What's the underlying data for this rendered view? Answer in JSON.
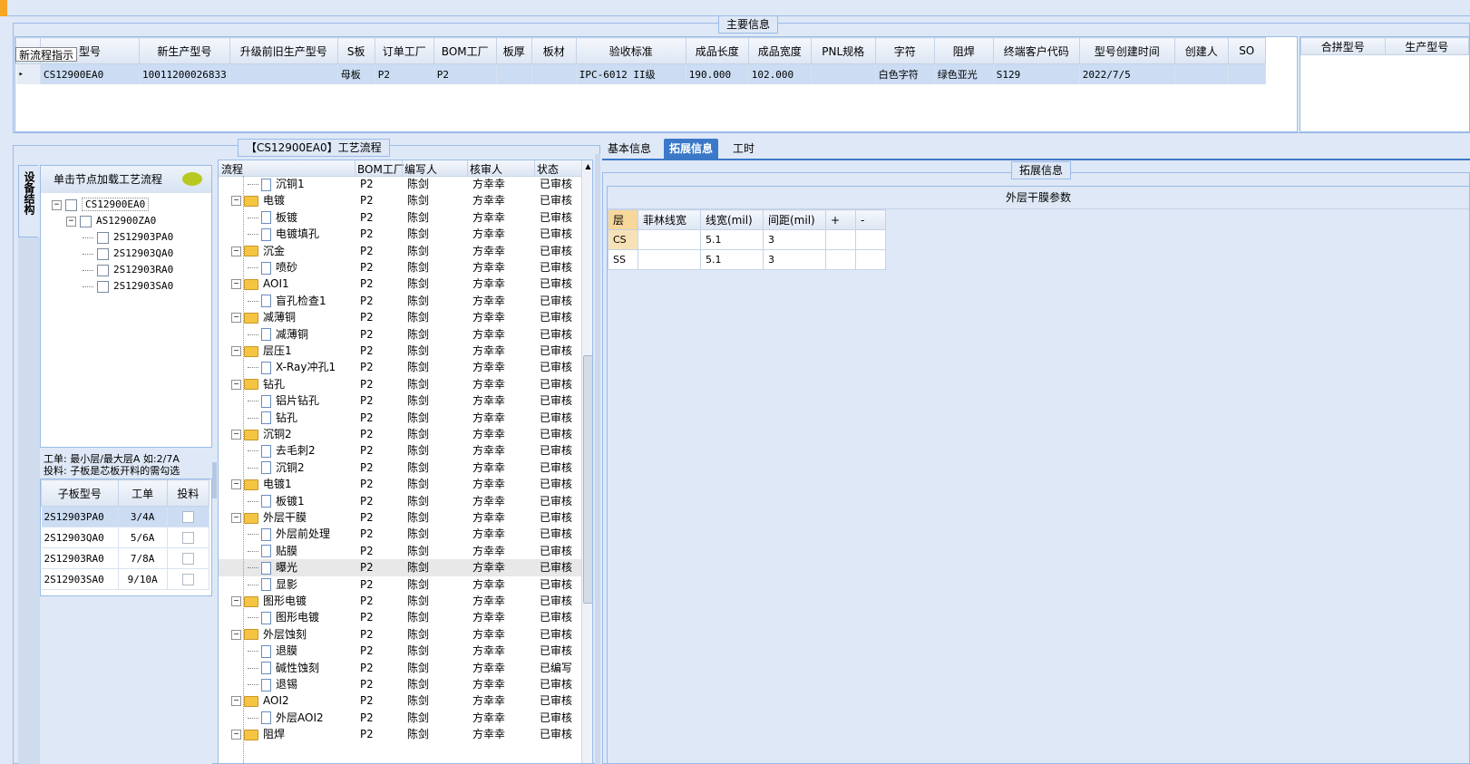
{
  "main_info": {
    "caption": "主要信息",
    "tooltip": "新流程指示",
    "columns": [
      "型号",
      "新生产型号",
      "升级前旧生产型号",
      "S板",
      "订单工厂",
      "BOM工厂",
      "板厚",
      "板材",
      "验收标准",
      "成品长度",
      "成品宽度",
      "PNL规格",
      "字符",
      "阻焊",
      "终端客户代码",
      "型号创建时间",
      "创建人",
      "SO"
    ],
    "row": [
      "CS12900EA0",
      "10011200026833",
      "",
      "母板",
      "P2",
      "P2",
      "",
      "",
      "IPC-6012 II级",
      "190.000",
      "102.000",
      "",
      "白色字符",
      "绿色亚光",
      "S129",
      "2022/7/5",
      "",
      ""
    ],
    "right_columns": [
      "合拼型号",
      "生产型号"
    ]
  },
  "left": {
    "vertical_tab": "设备结构",
    "hint": "单击节点加载工艺流程",
    "tree": [
      "CS12900EA0",
      "AS12900ZA0",
      "2S12903PA0",
      "2S12903QA0",
      "2S12903RA0",
      "2S12903SA0"
    ],
    "note1": "工单: 最小层/最大层A 如:2/7A",
    "note2": "投料: 子板是芯板开料的需勾选",
    "sub_columns": [
      "子板型号",
      "工单",
      "投料"
    ],
    "sub_rows": [
      {
        "model": "2S12903PA0",
        "order": "3/4A"
      },
      {
        "model": "2S12903QA0",
        "order": "5/6A"
      },
      {
        "model": "2S12903RA0",
        "order": "7/8A"
      },
      {
        "model": "2S12903SA0",
        "order": "9/10A"
      }
    ]
  },
  "flow": {
    "caption": "【CS12900EA0】工艺流程",
    "columns": [
      "流程",
      "BOM工厂",
      "编写人",
      "核审人",
      "状态"
    ],
    "rows": [
      {
        "name": "沉铜1",
        "type": "doc",
        "bom": "P2",
        "writer": "陈剑",
        "reviewer": "方幸幸",
        "status": "已审核"
      },
      {
        "name": "电镀",
        "type": "folder",
        "bom": "P2",
        "writer": "陈剑",
        "reviewer": "方幸幸",
        "status": "已审核"
      },
      {
        "name": "板镀",
        "type": "doc",
        "bom": "P2",
        "writer": "陈剑",
        "reviewer": "方幸幸",
        "status": "已审核"
      },
      {
        "name": "电镀填孔",
        "type": "doc",
        "bom": "P2",
        "writer": "陈剑",
        "reviewer": "方幸幸",
        "status": "已审核"
      },
      {
        "name": "沉金",
        "type": "folder",
        "bom": "P2",
        "writer": "陈剑",
        "reviewer": "方幸幸",
        "status": "已审核"
      },
      {
        "name": "喷砂",
        "type": "doc",
        "bom": "P2",
        "writer": "陈剑",
        "reviewer": "方幸幸",
        "status": "已审核"
      },
      {
        "name": "AOI1",
        "type": "folder",
        "bom": "P2",
        "writer": "陈剑",
        "reviewer": "方幸幸",
        "status": "已审核"
      },
      {
        "name": "盲孔检查1",
        "type": "doc",
        "bom": "P2",
        "writer": "陈剑",
        "reviewer": "方幸幸",
        "status": "已审核"
      },
      {
        "name": "减薄铜",
        "type": "folder",
        "bom": "P2",
        "writer": "陈剑",
        "reviewer": "方幸幸",
        "status": "已审核"
      },
      {
        "name": "减薄铜",
        "type": "doc",
        "bom": "P2",
        "writer": "陈剑",
        "reviewer": "方幸幸",
        "status": "已审核"
      },
      {
        "name": "层压1",
        "type": "folder",
        "bom": "P2",
        "writer": "陈剑",
        "reviewer": "方幸幸",
        "status": "已审核"
      },
      {
        "name": "X-Ray冲孔1",
        "type": "doc",
        "bom": "P2",
        "writer": "陈剑",
        "reviewer": "方幸幸",
        "status": "已审核"
      },
      {
        "name": "钻孔",
        "type": "folder",
        "bom": "P2",
        "writer": "陈剑",
        "reviewer": "方幸幸",
        "status": "已审核"
      },
      {
        "name": "铝片钻孔",
        "type": "doc",
        "bom": "P2",
        "writer": "陈剑",
        "reviewer": "方幸幸",
        "status": "已审核"
      },
      {
        "name": "钻孔",
        "type": "doc",
        "bom": "P2",
        "writer": "陈剑",
        "reviewer": "方幸幸",
        "status": "已审核"
      },
      {
        "name": "沉铜2",
        "type": "folder",
        "bom": "P2",
        "writer": "陈剑",
        "reviewer": "方幸幸",
        "status": "已审核"
      },
      {
        "name": "去毛刺2",
        "type": "doc",
        "bom": "P2",
        "writer": "陈剑",
        "reviewer": "方幸幸",
        "status": "已审核"
      },
      {
        "name": "沉铜2",
        "type": "doc",
        "bom": "P2",
        "writer": "陈剑",
        "reviewer": "方幸幸",
        "status": "已审核"
      },
      {
        "name": "电镀1",
        "type": "folder",
        "bom": "P2",
        "writer": "陈剑",
        "reviewer": "方幸幸",
        "status": "已审核"
      },
      {
        "name": "板镀1",
        "type": "doc",
        "bom": "P2",
        "writer": "陈剑",
        "reviewer": "方幸幸",
        "status": "已审核"
      },
      {
        "name": "外层干膜",
        "type": "folder",
        "bom": "P2",
        "writer": "陈剑",
        "reviewer": "方幸幸",
        "status": "已审核"
      },
      {
        "name": "外层前处理",
        "type": "doc",
        "bom": "P2",
        "writer": "陈剑",
        "reviewer": "方幸幸",
        "status": "已审核"
      },
      {
        "name": "贴膜",
        "type": "doc",
        "bom": "P2",
        "writer": "陈剑",
        "reviewer": "方幸幸",
        "status": "已审核"
      },
      {
        "name": "曝光",
        "type": "doc",
        "bom": "P2",
        "writer": "陈剑",
        "reviewer": "方幸幸",
        "status": "已审核",
        "selected": true
      },
      {
        "name": "显影",
        "type": "doc",
        "bom": "P2",
        "writer": "陈剑",
        "reviewer": "方幸幸",
        "status": "已审核"
      },
      {
        "name": "图形电镀",
        "type": "folder",
        "bom": "P2",
        "writer": "陈剑",
        "reviewer": "方幸幸",
        "status": "已审核"
      },
      {
        "name": "图形电镀",
        "type": "doc",
        "bom": "P2",
        "writer": "陈剑",
        "reviewer": "方幸幸",
        "status": "已审核"
      },
      {
        "name": "外层蚀刻",
        "type": "folder",
        "bom": "P2",
        "writer": "陈剑",
        "reviewer": "方幸幸",
        "status": "已审核"
      },
      {
        "name": "退膜",
        "type": "doc",
        "bom": "P2",
        "writer": "陈剑",
        "reviewer": "方幸幸",
        "status": "已审核"
      },
      {
        "name": "碱性蚀刻",
        "type": "doc",
        "bom": "P2",
        "writer": "陈剑",
        "reviewer": "方幸幸",
        "status": "已编写"
      },
      {
        "name": "退锡",
        "type": "doc",
        "bom": "P2",
        "writer": "陈剑",
        "reviewer": "方幸幸",
        "status": "已审核"
      },
      {
        "name": "AOI2",
        "type": "folder",
        "bom": "P2",
        "writer": "陈剑",
        "reviewer": "方幸幸",
        "status": "已审核"
      },
      {
        "name": "外层AOI2",
        "type": "doc",
        "bom": "P2",
        "writer": "陈剑",
        "reviewer": "方幸幸",
        "status": "已审核"
      },
      {
        "name": "阻焊",
        "type": "folder",
        "bom": "P2",
        "writer": "陈剑",
        "reviewer": "方幸幸",
        "status": "已审核"
      }
    ]
  },
  "right": {
    "tabs": [
      "基本信息",
      "拓展信息",
      "工时"
    ],
    "active_tab": 1,
    "caption": "拓展信息",
    "table_title": "外层干膜参数",
    "columns": [
      "层",
      "菲林线宽",
      "线宽(mil)",
      "间距(mil)",
      "+",
      "-"
    ],
    "rows": [
      [
        "CS",
        "",
        "5.1",
        "3",
        "",
        ""
      ],
      [
        "SS",
        "",
        "5.1",
        "3",
        "",
        ""
      ]
    ]
  }
}
